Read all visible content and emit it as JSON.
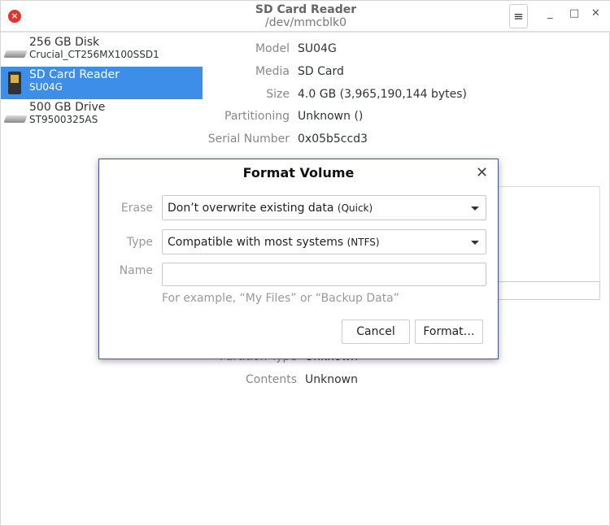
{
  "window": {
    "title": "SD Card Reader",
    "subtitle": "/dev/mmcblk0",
    "menu_icon": "hamburger-icon",
    "minimize": "_",
    "maximize": "□",
    "close": "✕"
  },
  "devices": [
    {
      "name": "256 GB Disk",
      "model": "Crucial_CT256MX100SSD1",
      "icon": "drive-icon"
    },
    {
      "name": "SD Card Reader",
      "model": "SU04G",
      "icon": "sd-card-icon",
      "selected": true
    },
    {
      "name": "500 GB Drive",
      "model": "ST9500325AS",
      "icon": "drive-icon"
    }
  ],
  "props": [
    {
      "label": "Model",
      "value": "SU04G"
    },
    {
      "label": "Media",
      "value": "SD Card"
    },
    {
      "label": "Size",
      "value": "4.0 GB (3,965,190,144 bytes)"
    },
    {
      "label": "Partitioning",
      "value": "Unknown ()"
    },
    {
      "label": "Serial Number",
      "value": "0x05b5ccd3"
    }
  ],
  "volume_props": [
    {
      "label": "Partition Type",
      "value": "Unknown"
    },
    {
      "label": "Contents",
      "value": "Unknown"
    }
  ],
  "dialog": {
    "title": "Format Volume",
    "close": "✕",
    "erase_label": "Erase",
    "erase_value": "Don’t overwrite existing data",
    "erase_note": "(Quick)",
    "type_label": "Type",
    "type_value": "Compatible with most systems",
    "type_note": "(NTFS)",
    "name_label": "Name",
    "name_value": "",
    "name_hint": "For example, “My Files” or “Backup Data”",
    "cancel": "Cancel",
    "format": "Format…"
  },
  "colors": {
    "selection": "#3d8ee9",
    "dialog_border": "#2b55c8",
    "close_red": "#e5332a"
  }
}
